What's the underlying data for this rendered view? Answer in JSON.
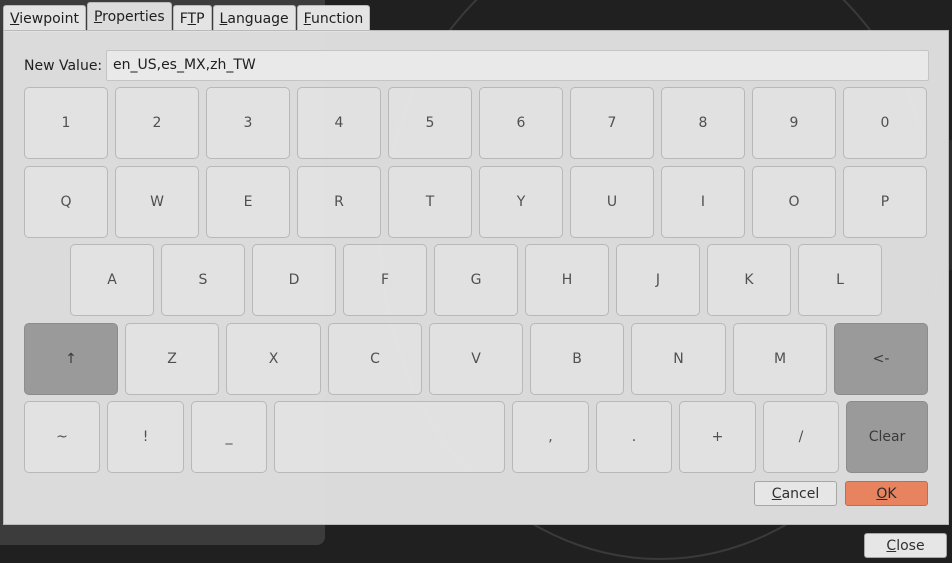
{
  "tabs": [
    {
      "label": "Viewpoint",
      "active": false
    },
    {
      "label": "Properties",
      "active": true
    },
    {
      "label": "FTP",
      "active": false
    },
    {
      "label": "Language",
      "active": false
    },
    {
      "label": "Function",
      "active": false
    }
  ],
  "form": {
    "new_value_label": "New Value:",
    "new_value": "en_US,es_MX,zh_TW"
  },
  "keyboard": {
    "row1": [
      "1",
      "2",
      "3",
      "4",
      "5",
      "6",
      "7",
      "8",
      "9",
      "0"
    ],
    "row2": [
      "Q",
      "W",
      "E",
      "R",
      "T",
      "Y",
      "U",
      "I",
      "O",
      "P"
    ],
    "row3": [
      "A",
      "S",
      "D",
      "F",
      "G",
      "H",
      "J",
      "K",
      "L"
    ],
    "row4": [
      "↑",
      "Z",
      "X",
      "C",
      "V",
      "B",
      "N",
      "M",
      "<-"
    ],
    "row5": [
      "~",
      "!",
      "_",
      "",
      ",",
      ".",
      "+",
      "/",
      "Clear"
    ]
  },
  "buttons": {
    "cancel": "Cancel",
    "ok": "OK",
    "close": "Close"
  },
  "colors": {
    "accent_ok": "#e8835f",
    "special_key": "#9a9a9a"
  }
}
